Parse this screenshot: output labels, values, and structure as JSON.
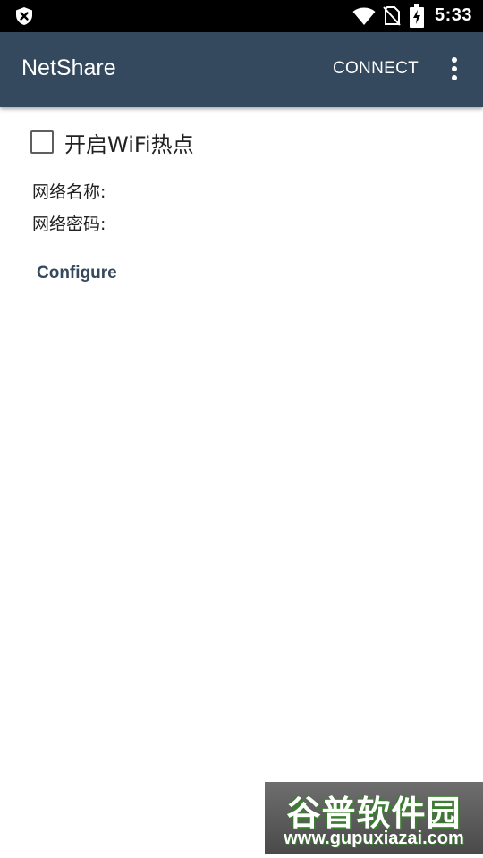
{
  "status_bar": {
    "time": "5:33",
    "icons": [
      "shield-close-icon",
      "wifi-icon",
      "no-sim-icon",
      "battery-charging-icon"
    ]
  },
  "app_bar": {
    "title": "NetShare",
    "connect_label": "CONNECT",
    "overflow_icon": "more-vert-icon"
  },
  "content": {
    "hotspot_checkbox": {
      "label": "开启WiFi热点",
      "checked": false
    },
    "network_name_label": "网络名称:",
    "network_password_label": "网络密码:",
    "configure_label": "Configure"
  },
  "watermark": {
    "title": "谷普软件园",
    "url": "www.gupuxiazai.com"
  },
  "colors": {
    "app_bar": "#34495e",
    "status_bar": "#000000",
    "accent": "#34495e"
  }
}
